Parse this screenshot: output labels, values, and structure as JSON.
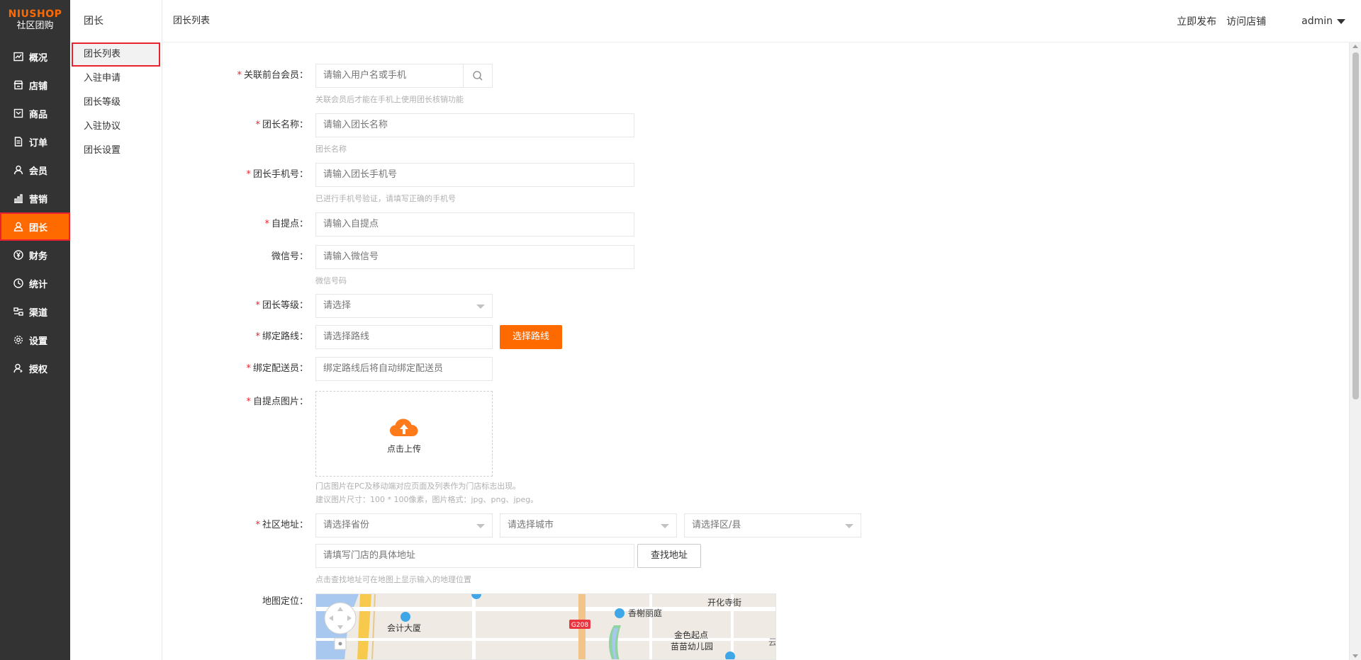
{
  "sidebar": {
    "brand": "NIUSHOP",
    "brand_sub": "社区团购",
    "items": [
      {
        "label": "概况"
      },
      {
        "label": "店铺"
      },
      {
        "label": "商品"
      },
      {
        "label": "订单"
      },
      {
        "label": "会员"
      },
      {
        "label": "营销"
      },
      {
        "label": "团长"
      },
      {
        "label": "财务"
      },
      {
        "label": "统计"
      },
      {
        "label": "渠道"
      },
      {
        "label": "设置"
      },
      {
        "label": "授权"
      }
    ],
    "active": "团长"
  },
  "submenu": {
    "title": "团长",
    "items": [
      {
        "label": "团长列表"
      },
      {
        "label": "入驻申请"
      },
      {
        "label": "团长等级"
      },
      {
        "label": "入驻协议"
      },
      {
        "label": "团长设置"
      }
    ]
  },
  "header": {
    "breadcrumb": "团长列表",
    "publish": "立即发布",
    "visit_store": "访问店铺",
    "user": "admin"
  },
  "form": {
    "member": {
      "label": "关联前台会员：",
      "placeholder": "请输入用户名或手机",
      "hint": "关联会员后才能在手机上使用团长核销功能"
    },
    "name": {
      "label": "团长名称：",
      "placeholder": "请输入团长名称",
      "hint": "团长名称"
    },
    "phone": {
      "label": "团长手机号：",
      "placeholder": "请输入团长手机号",
      "hint": "已进行手机号验证，请填写正确的手机号"
    },
    "pickup": {
      "label": "自提点：",
      "placeholder": "请输入自提点"
    },
    "wechat": {
      "label": "微信号：",
      "placeholder": "请输入微信号",
      "hint": "微信号码"
    },
    "level": {
      "label": "团长等级：",
      "value": "请选择"
    },
    "route": {
      "label": "绑定路线：",
      "placeholder": "请选择路线",
      "button": "选择路线"
    },
    "courier": {
      "label": "绑定配送员：",
      "placeholder": "绑定路线后将自动绑定配送员"
    },
    "image": {
      "label": "自提点图片：",
      "upload": "点击上传",
      "hint1": "门店图片在PC及移动端对应页面及列表作为门店标志出现。",
      "hint2": "建议图片尺寸：100 * 100像素，图片格式：jpg、png、jpeg。"
    },
    "address": {
      "label": "社区地址：",
      "province": "请选择省份",
      "city": "请选择城市",
      "district": "请选择区/县",
      "detail_placeholder": "请填写门店的具体地址",
      "find_button": "查找地址",
      "hint": "点击查找地址可在地图上显示输入的地理位置"
    },
    "map": {
      "label": "地图定位：",
      "places": [
        "会计大厦",
        "香榭丽庭",
        "开化寺街",
        "金色起点",
        "苗苗幼儿园",
        "G208",
        "云"
      ]
    }
  },
  "colors": {
    "accent": "#ff6a00",
    "sidebar_bg": "#333333",
    "required": "#e8232f"
  }
}
